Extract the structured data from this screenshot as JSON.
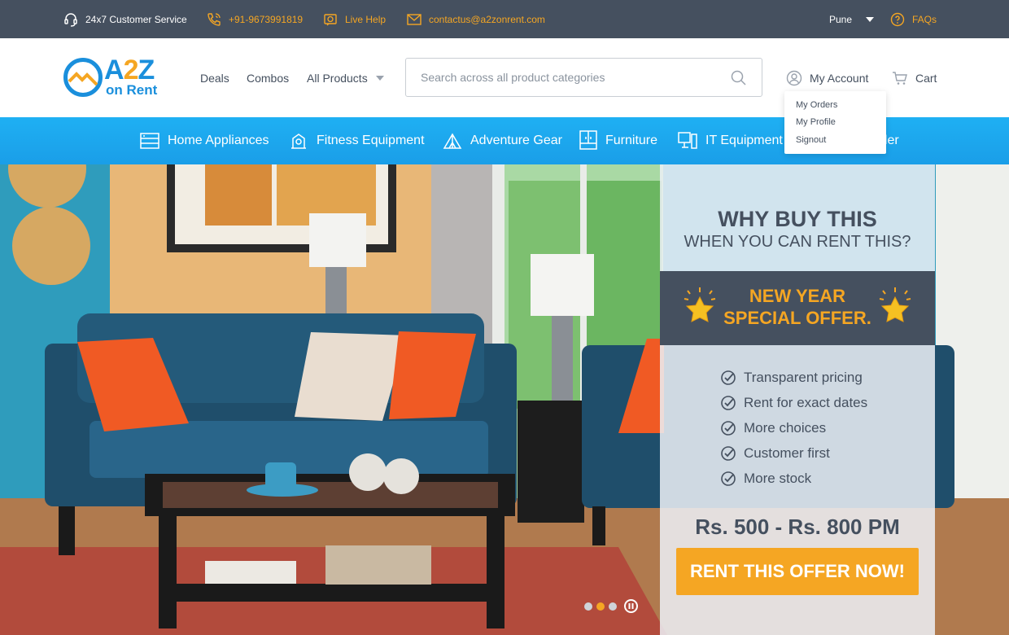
{
  "topbar": {
    "customer_service": "24x7 Customer Service",
    "phone": "+91-9673991819",
    "live_help": "Live Help",
    "email": "contactus@a2zonrent.com",
    "city": "Pune",
    "faqs": "FAQs"
  },
  "header": {
    "logo_main_a": "A",
    "logo_main_2": "2",
    "logo_main_z": "Z",
    "logo_sub": "on Rent",
    "nav": {
      "deals": "Deals",
      "combos": "Combos",
      "all_products": "All Products"
    },
    "search_placeholder": "Search across all product categories",
    "account": "My Account",
    "cart": "Cart"
  },
  "account_menu": {
    "orders": "My Orders",
    "profile": "My Profile",
    "signout": "Signout"
  },
  "categories": [
    "Home Appliances",
    "Fitness Equipment",
    "Adventure Gear",
    "Furniture",
    "IT Equipment",
    "eler"
  ],
  "promo": {
    "headline": "WHY BUY THIS",
    "subheadline": "WHEN YOU CAN RENT THIS?",
    "offer_line1": "NEW YEAR",
    "offer_line2": "SPECIAL OFFER.",
    "features": [
      "Transparent pricing",
      "Rent for exact dates",
      "More choices",
      "Customer first",
      "More stock"
    ],
    "price": "Rs. 500 - Rs. 800 PM",
    "cta": "RENT THIS OFFER NOW!"
  },
  "carousel": {
    "slides": 3,
    "active": 2
  },
  "colors": {
    "dark": "#45505f",
    "accent": "#f5a623",
    "brand_blue": "#1a8fdc",
    "category_blue": "#1fb0f3"
  }
}
